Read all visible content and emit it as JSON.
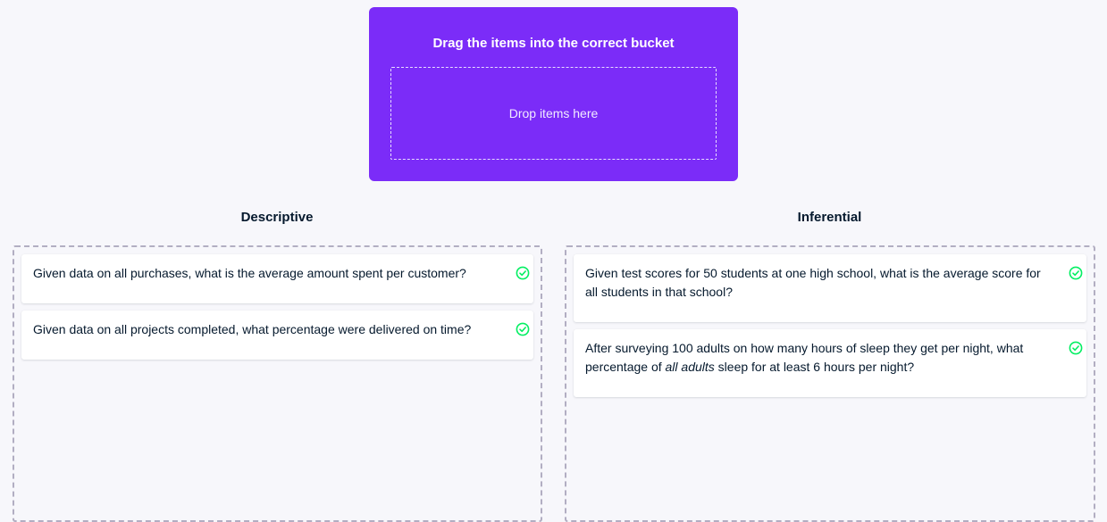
{
  "source": {
    "title": "Drag the items into the correct bucket",
    "drop_placeholder": "Drop items here"
  },
  "buckets": [
    {
      "title": "Descriptive",
      "items": [
        {
          "text": "Given data on all purchases, what is the average amount spent per customer?",
          "status": "correct"
        },
        {
          "text": "Given data on all projects completed, what percentage were delivered on time?",
          "status": "correct"
        }
      ]
    },
    {
      "title": "Inferential",
      "items": [
        {
          "text": "Given test scores for 50 students at one high school, what is the average score for all students in that school?",
          "status": "correct"
        },
        {
          "text_before": "After surveying 100 adults on how many hours of sleep they get per night, what percentage of ",
          "text_em": "all adults",
          "text_after": " sleep for at least 6 hours per night?",
          "status": "correct"
        }
      ]
    }
  ],
  "colors": {
    "accent": "#7b2cf8",
    "correct": "#03ef62",
    "background": "#f7f7fb",
    "text": "#05192d"
  },
  "icons": {
    "status": "check-circle-icon"
  }
}
